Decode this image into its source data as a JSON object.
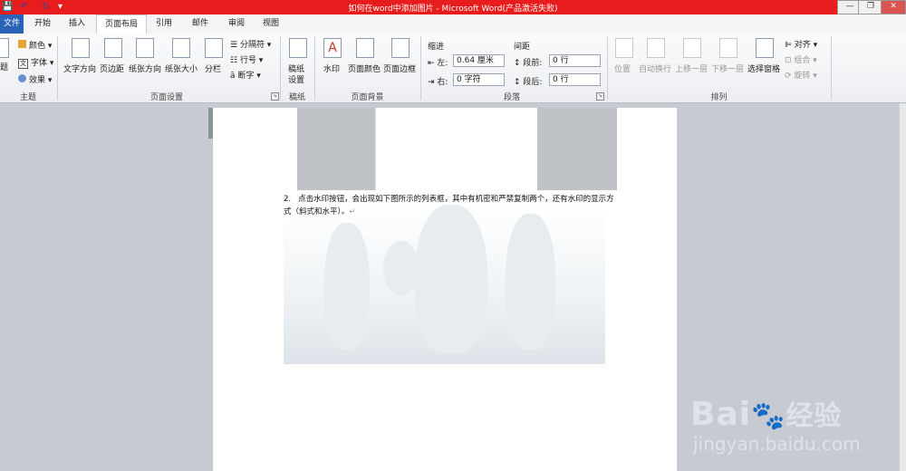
{
  "window": {
    "title": "如何在word中添加图片 - Microsoft Word(产品激活失败)",
    "controls": [
      "—",
      "❐",
      "✕"
    ]
  },
  "qat": [
    "💾",
    "↶",
    "↻",
    "▾"
  ],
  "tabs": [
    {
      "label": "文件"
    },
    {
      "label": "开始"
    },
    {
      "label": "插入"
    },
    {
      "label": "页面布局"
    },
    {
      "label": "引用"
    },
    {
      "label": "邮件"
    },
    {
      "label": "审阅"
    },
    {
      "label": "视图"
    }
  ],
  "ribbon": {
    "theme": {
      "group_label": "主题",
      "themes_label": "题",
      "colors": "颜色 ▾",
      "fonts": "字体 ▾",
      "effects": "效果 ▾"
    },
    "page_setup": {
      "group_label": "页面设置",
      "text_direction": "文字方向",
      "margins": "页边距",
      "orientation": "纸张方向",
      "size": "纸张大小",
      "columns": "分栏",
      "breaks": "分隔符 ▾",
      "line_numbers": "行号 ▾",
      "hyphenation": "断字 ▾"
    },
    "draft": {
      "group_label": "稿纸",
      "settings_line1": "稿纸",
      "settings_line2": "设置"
    },
    "page_background": {
      "group_label": "页面背景",
      "watermark": "水印",
      "page_color": "页面颜色",
      "page_borders": "页面边框"
    },
    "paragraph": {
      "group_label": "段落",
      "indent_label": "缩进",
      "left_label": "左:",
      "left_value": "0.64 厘米",
      "right_label": "右:",
      "right_value": "0 字符",
      "spacing_label": "间距",
      "before_label": "段前:",
      "before_value": "0 行",
      "after_label": "段后:",
      "after_value": "0 行"
    },
    "arrange": {
      "group_label": "排列",
      "position": "位置",
      "wrap": "自动换行",
      "bring_forward": "上移一层",
      "send_backward": "下移一层",
      "selection_pane": "选择窗格",
      "align": "对齐 ▾",
      "group": "组合 ▾",
      "rotate": "旋转 ▾"
    }
  },
  "document": {
    "list_number": "2.",
    "list_text": "点击水印按钮，会出现如下图所示的列表框，其中有机密和严禁复制两个，还有水印的显示方式（斜式和水平）。",
    "paragraph_mark": "↵"
  },
  "watermark_site": {
    "brand": "Bai",
    "brand_paw": "🐾",
    "brand_cn": "经验",
    "url": "jingyan.baidu.com"
  },
  "colors": {
    "titlebar": "#e81c1c",
    "file_tab": "#2a62b8"
  }
}
